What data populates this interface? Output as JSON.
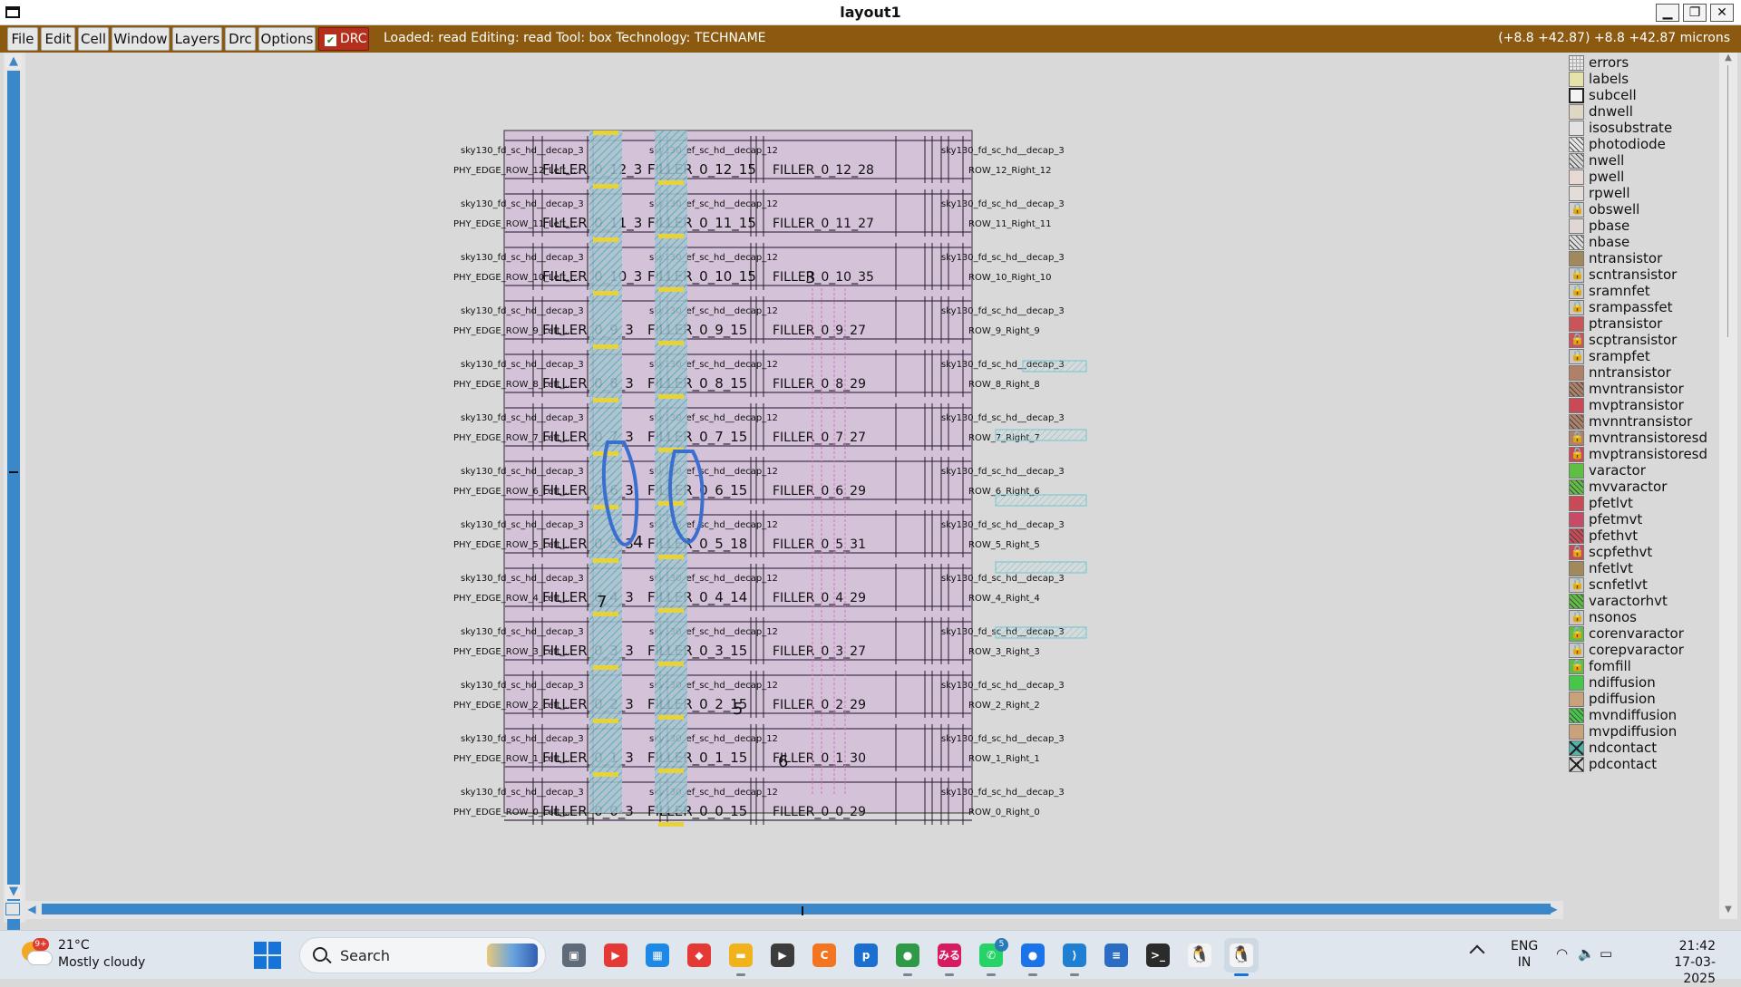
{
  "window": {
    "title": "layout1",
    "minimize_glyph": "▁",
    "maximize_glyph": "❐",
    "close_glyph": "✕"
  },
  "menu": {
    "items": [
      "File",
      "Edit",
      "Cell",
      "Window",
      "Layers",
      "Drc",
      "Options"
    ],
    "drc_toggle": {
      "label": "DRC",
      "checked": true
    },
    "status": "Loaded: read Editing: read Tool: box  Technology: TECHNAME",
    "coords": "(+8.8 +42.87) +8.8 +42.87 microns"
  },
  "layout": {
    "rows": [
      {
        "top_left": "sky130_fd_sc_hd__decap_3",
        "edge": "PHY_EDGE_ROW_12_Left_...",
        "filler_a": "FILLER_0_12_3",
        "filler_b": "FILLER_0_12_15",
        "filler_c": "FILLER_0_12_28",
        "right": "ROW_12_Right_12"
      },
      {
        "top_left": "sky130_fd_sc_hd__decap_3",
        "edge": "PHY_EDGE_ROW_11_Left_...",
        "filler_a": "FILLER_0_11_3",
        "filler_b": "FILLER_0_11_15",
        "filler_c": "FILLER_0_11_27",
        "right": "ROW_11_Right_11"
      },
      {
        "top_left": "sky130_fd_sc_hd__decap_3",
        "edge": "PHY_EDGE_ROW_10_Left_...",
        "filler_a": "FILLER_0_10_3",
        "filler_b": "FILLER_0_10_15",
        "filler_c": "FILLER_0_10_35",
        "right": "ROW_10_Right_10"
      },
      {
        "top_left": "sky130_fd_sc_hd__decap_3",
        "edge": "PHY_EDGE_ROW_9_Left_...",
        "filler_a": "FILLER_0_9_3",
        "filler_b": "FILLER_0_9_15",
        "filler_c": "FILLER_0_9_27",
        "right": "ROW_9_Right_9"
      },
      {
        "top_left": "sky130_fd_sc_hd__decap_3",
        "edge": "PHY_EDGE_ROW_8_Left_...",
        "filler_a": "FILLER_0_8_3",
        "filler_b": "FILLER_0_8_15",
        "filler_c": "FILLER_0_8_29",
        "right": "ROW_8_Right_8"
      },
      {
        "top_left": "sky130_fd_sc_hd__decap_3",
        "edge": "PHY_EDGE_ROW_7_Left_...",
        "filler_a": "FILLER_0_7_3",
        "filler_b": "FILLER_0_7_15",
        "filler_c": "FILLER_0_7_27",
        "right": "ROW_7_Right_7"
      },
      {
        "top_left": "sky130_fd_sc_hd__decap_3",
        "edge": "PHY_EDGE_ROW_6_Left_...",
        "filler_a": "FILLER_0_6_3",
        "filler_b": "FILLER_0_6_15",
        "filler_c": "FILLER_0_6_29",
        "right": "ROW_6_Right_6"
      },
      {
        "top_left": "sky130_fd_sc_hd__decap_3",
        "edge": "PHY_EDGE_ROW_5_Left_...",
        "filler_a": "FILLER_0_5_3",
        "filler_b": "FILLER_0_5_18",
        "filler_c": "FILLER_0_5_31",
        "right": "ROW_5_Right_5"
      },
      {
        "top_left": "sky130_fd_sc_hd__decap_3",
        "edge": "PHY_EDGE_ROW_4_Left_...",
        "filler_a": "FILLER_0_4_3",
        "filler_b": "FILLER_0_4_14",
        "filler_c": "FILLER_0_4_29",
        "right": "ROW_4_Right_4"
      },
      {
        "top_left": "sky130_fd_sc_hd__decap_3",
        "edge": "PHY_EDGE_ROW_3_Left_...",
        "filler_a": "FILLER_0_3_3",
        "filler_b": "FILLER_0_3_15",
        "filler_c": "FILLER_0_3_27",
        "right": "ROW_3_Right_3"
      },
      {
        "top_left": "sky130_fd_sc_hd__decap_3",
        "edge": "PHY_EDGE_ROW_2_Left_...",
        "filler_a": "FILLER_0_2_3",
        "filler_b": "FILLER_0_2_15",
        "filler_c": "FILLER_0_2_29",
        "right": "ROW_2_Right_2"
      },
      {
        "top_left": "sky130_fd_sc_hd__decap_3",
        "edge": "PHY_EDGE_ROW_1_Left_...",
        "filler_a": "FILLER_0_1_3",
        "filler_b": "FILLER_0_1_15",
        "filler_c": "FILLER_0_1_30",
        "right": "ROW_1_Right_1"
      },
      {
        "top_left": "sky130_fd_sc_hd__decap_3",
        "edge": "PHY_EDGE_ROW_0_Left_...",
        "filler_a": "FILLER_0_0_3",
        "filler_b": "FILLER_0_0_15",
        "filler_c": "FILLER_0_0_29",
        "right": "ROW_0_Right_0"
      }
    ],
    "mid_label": "sky130_ef_sc_hd__decap_12",
    "right_label": "sky130_fd_sc_hd__decap_3",
    "numbers": [
      "3",
      "4",
      "7",
      "5",
      "6"
    ]
  },
  "layers_panel": {
    "items": [
      {
        "name": "errors",
        "color": "#e8e8e8",
        "style": "grid"
      },
      {
        "name": "labels",
        "color": "#e6e3a8",
        "style": "plain"
      },
      {
        "name": "subcell",
        "color": "#f2f2f2",
        "style": "box"
      },
      {
        "name": "dnwell",
        "color": "#ddd7c4",
        "style": "plain"
      },
      {
        "name": "isosubstrate",
        "color": "#e2e2e2",
        "style": "plain"
      },
      {
        "name": "photodiode",
        "color": "#e6e6e6",
        "style": "hatch"
      },
      {
        "name": "nwell",
        "color": "#d7d7d7",
        "style": "hatch"
      },
      {
        "name": "pwell",
        "color": "#e8d9d4",
        "style": "plain"
      },
      {
        "name": "rpwell",
        "color": "#e3dcd8",
        "style": "plain"
      },
      {
        "name": "obswell",
        "color": "#d0d0d0",
        "style": "lock"
      },
      {
        "name": "pbase",
        "color": "#e0d6d3",
        "style": "plain"
      },
      {
        "name": "nbase",
        "color": "#dddddd",
        "style": "hatch"
      },
      {
        "name": "ntransistor",
        "color": "#a08a5c",
        "style": "plain"
      },
      {
        "name": "scntransistor",
        "color": "#c9c9c9",
        "style": "lock"
      },
      {
        "name": "sramnfet",
        "color": "#c9c9c9",
        "style": "lock"
      },
      {
        "name": "srampassfet",
        "color": "#c9c9c9",
        "style": "lock"
      },
      {
        "name": "ptransistor",
        "color": "#c9545a",
        "style": "plain"
      },
      {
        "name": "scptransistor",
        "color": "#c9545a",
        "style": "lock"
      },
      {
        "name": "srampfet",
        "color": "#c9c9c9",
        "style": "lock"
      },
      {
        "name": "nntransistor",
        "color": "#b08068",
        "style": "plain"
      },
      {
        "name": "mvntransistor",
        "color": "#b08068",
        "style": "hatch"
      },
      {
        "name": "mvptransistor",
        "color": "#c94a56",
        "style": "plain"
      },
      {
        "name": "mvnntransistor",
        "color": "#b08068",
        "style": "hatch"
      },
      {
        "name": "mvntransistoresd",
        "color": "#b08068",
        "style": "lock"
      },
      {
        "name": "mvptransistoresd",
        "color": "#c94a56",
        "style": "lock"
      },
      {
        "name": "varactor",
        "color": "#5fbf42",
        "style": "plain"
      },
      {
        "name": "mvvaractor",
        "color": "#5fbf42",
        "style": "hatch"
      },
      {
        "name": "pfetlvt",
        "color": "#c94a56",
        "style": "plain"
      },
      {
        "name": "pfetmvt",
        "color": "#c94a68",
        "style": "plain"
      },
      {
        "name": "pfethvt",
        "color": "#c94a56",
        "style": "hatch"
      },
      {
        "name": "scpfethvt",
        "color": "#c94a56",
        "style": "lock"
      },
      {
        "name": "nfetlvt",
        "color": "#a08a5c",
        "style": "plain"
      },
      {
        "name": "scnfetlvt",
        "color": "#c9c9c9",
        "style": "lock"
      },
      {
        "name": "varactorhvt",
        "color": "#5fbf42",
        "style": "hatch"
      },
      {
        "name": "nsonos",
        "color": "#c9c9c9",
        "style": "lock"
      },
      {
        "name": "corenvaractor",
        "color": "#5fbf42",
        "style": "lock"
      },
      {
        "name": "corepvaractor",
        "color": "#c9c9c9",
        "style": "lock"
      },
      {
        "name": "fomfill",
        "color": "#5fbf42",
        "style": "lock"
      },
      {
        "name": "ndiffusion",
        "color": "#46c74a",
        "style": "plain"
      },
      {
        "name": "pdiffusion",
        "color": "#c9a27a",
        "style": "plain"
      },
      {
        "name": "mvndiffusion",
        "color": "#46c74a",
        "style": "hatch"
      },
      {
        "name": "mvpdiffusion",
        "color": "#c9a27a",
        "style": "plain"
      },
      {
        "name": "ndcontact",
        "color": "#4fb2a8",
        "style": "x"
      },
      {
        "name": "pdcontact",
        "color": "#cfcfcf",
        "style": "x"
      }
    ]
  },
  "taskbar": {
    "weather": {
      "temp": "21°C",
      "desc": "Mostly cloudy",
      "alert": "9+"
    },
    "search_label": "Search",
    "apps": [
      {
        "name": "task-view",
        "glyph": "▣",
        "color": "#5f6b78"
      },
      {
        "name": "youtube",
        "glyph": "▶",
        "color": "#e53935"
      },
      {
        "name": "microsoft-store",
        "glyph": "▦",
        "color": "#1e88e5"
      },
      {
        "name": "app-red-diamond",
        "glyph": "◆",
        "color": "#e53935"
      },
      {
        "name": "file-explorer",
        "glyph": "▬",
        "color": "#f1b31c"
      },
      {
        "name": "media-player",
        "glyph": "▶",
        "color": "#3c3c3c"
      },
      {
        "name": "crunchyroll",
        "glyph": "C",
        "color": "#f47521"
      },
      {
        "name": "prime-video",
        "glyph": "p",
        "color": "#1a6fd1"
      },
      {
        "name": "chrome",
        "glyph": "●",
        "color": "#2e9a47"
      },
      {
        "name": "app-japanese",
        "glyph": "みる",
        "color": "#d81b60"
      },
      {
        "name": "whatsapp",
        "glyph": "✆",
        "color": "#25d366",
        "badge": "5"
      },
      {
        "name": "chrome-profile",
        "glyph": "●",
        "color": "#1a73e8"
      },
      {
        "name": "vscode",
        "glyph": "⟩",
        "color": "#1f7fd3"
      },
      {
        "name": "notepad",
        "glyph": "≡",
        "color": "#2b6cc4"
      },
      {
        "name": "terminal",
        "glyph": ">_",
        "color": "#2b2b2b"
      },
      {
        "name": "linux-app",
        "glyph": "🐧",
        "color": "#f3f3f3"
      },
      {
        "name": "linux-app-active",
        "glyph": "🐧",
        "color": "#f3f3f3"
      }
    ],
    "lang_line1": "ENG",
    "lang_line2": "IN",
    "time": "21:42",
    "date": "17-03-2025"
  }
}
